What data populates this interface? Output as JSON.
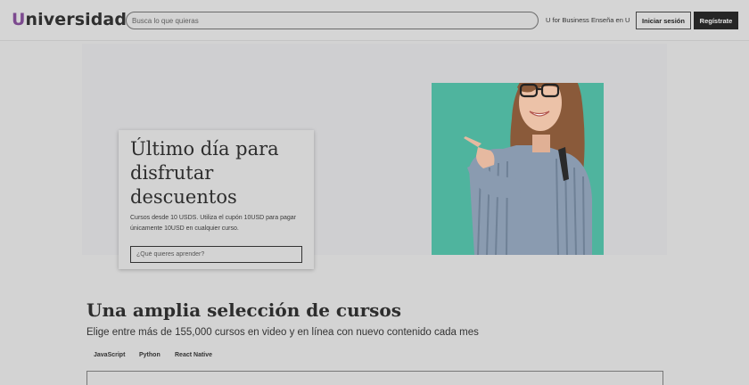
{
  "header": {
    "logo_first": "U",
    "logo_rest": "niversidad",
    "search_placeholder": "Busca lo que quieras",
    "business_link": "U for Business",
    "teach_link": "Enseña en U",
    "login_label": "Iniciar sesión",
    "signup_label": "Regístrate"
  },
  "hero": {
    "title": "Último día para disfrutar descuentos",
    "text": "Cursos desde 10 USDS. Utiliza el cupón 10USD para pagar únicamente 10USD en cualquier curso.",
    "search_placeholder": "¿Qué quieres aprender?"
  },
  "courses": {
    "title": "Una amplia selección de cursos",
    "subtitle": "Elige entre más de 155,000 cursos en video y en línea con nuevo contenido cada mes",
    "tabs": [
      "JavaScript",
      "Python",
      "React Native"
    ]
  },
  "colors": {
    "brand_u": "#7c4a8f",
    "hero_photo_bg": "#4fb49e",
    "signup_bg": "#262626"
  }
}
